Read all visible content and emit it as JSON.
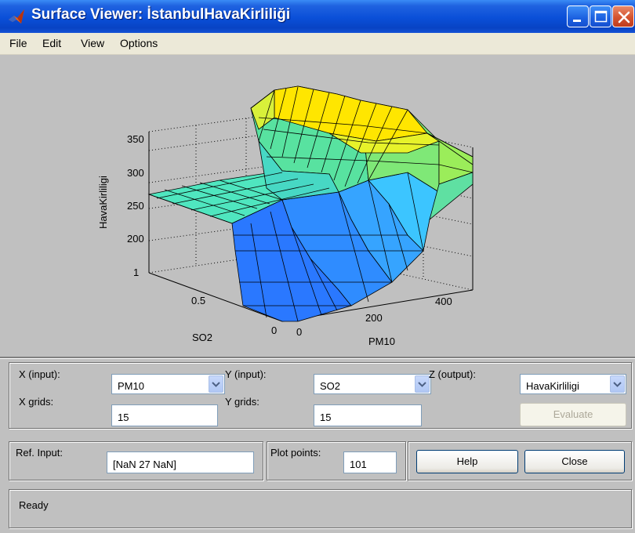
{
  "window": {
    "title": "Surface Viewer: İstanbulHavaKirliliği"
  },
  "menu": [
    "File",
    "Edit",
    "View",
    "Options"
  ],
  "plot": {
    "zlabel": "HavaKirliligi",
    "xlabel": "PM10",
    "ylabel": "SO2",
    "z_ticks": [
      "350",
      "300",
      "250",
      "200"
    ],
    "x_ticks": [
      "0",
      "200",
      "400"
    ],
    "y_ticks": [
      "1",
      "0.5",
      "0"
    ],
    "colors": {
      "low": "#2a6fff",
      "mid": "#3fe0b0",
      "high": "#ffe600"
    }
  },
  "controls": {
    "x_input_label": "X (input):",
    "x_input_value": "PM10",
    "y_input_label": "Y (input):",
    "y_input_value": "SO2",
    "z_output_label": "Z (output):",
    "z_output_value": "HavaKirliligi",
    "x_grids_label": "X grids:",
    "x_grids_value": "15",
    "y_grids_label": "Y grids:",
    "y_grids_value": "15",
    "evaluate_label": "Evaluate",
    "ref_input_label": "Ref. Input:",
    "ref_input_value": "[NaN 27 NaN]",
    "plot_points_label": "Plot points:",
    "plot_points_value": "101",
    "help_label": "Help",
    "close_label": "Close"
  },
  "status": {
    "text": "Ready"
  }
}
